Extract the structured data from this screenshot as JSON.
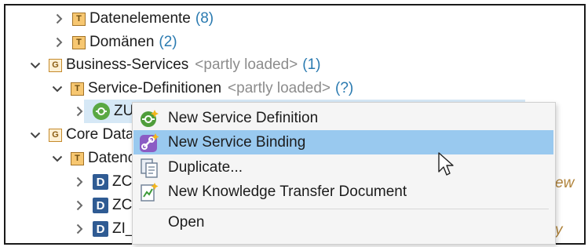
{
  "tree": {
    "rows": [
      {
        "label": "Datenelemente",
        "count": "(8)"
      },
      {
        "label": "Domänen",
        "count": "(2)"
      },
      {
        "label": "Business-Services",
        "partial": "<partly loaded>",
        "count": "(1)"
      },
      {
        "label": "Service-Definitionen",
        "partial": "<partly loaded>",
        "count": "(?)"
      },
      {
        "label": "ZUI"
      },
      {
        "label": "Core Data"
      },
      {
        "label": "Datenc"
      },
      {
        "label": "ZC_"
      },
      {
        "label": "ZC_"
      },
      {
        "label": "ZI_("
      }
    ],
    "ghost_text_1": "ew",
    "ghost_text_2": "y"
  },
  "context_menu": {
    "items": [
      {
        "label": "New Service Definition",
        "icon": "service-definition-icon"
      },
      {
        "label": "New Service Binding",
        "icon": "service-binding-icon"
      },
      {
        "label": "Duplicate...",
        "icon": "duplicate-icon"
      },
      {
        "label": "New Knowledge Transfer Document",
        "icon": "knowledge-transfer-icon"
      },
      {
        "label": "Open"
      }
    ],
    "highlighted": "New Service Binding"
  },
  "colors": {
    "selection": "#d6e8f6",
    "menu_highlight": "#99c9ef",
    "count": "#2a7ab0",
    "partial": "#8c8c8c",
    "service_green": "#5aa843",
    "ddic_blue": "#2f5b93"
  }
}
